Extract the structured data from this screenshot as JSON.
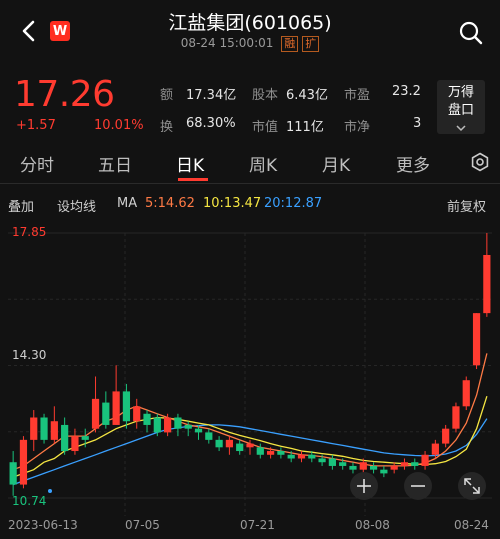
{
  "header": {
    "title": "江盐集团(601065)",
    "datetime": "08-24 15:00:01",
    "tag1": "融",
    "tag2": "扩",
    "logo_text": "W"
  },
  "quote": {
    "price": "17.26",
    "change": "+1.57",
    "change_pct": "10.01%",
    "stats": [
      {
        "label": "额",
        "value": "17.34亿"
      },
      {
        "label": "股本",
        "value": "6.43亿"
      },
      {
        "label": "市盈",
        "value": "23.2"
      },
      {
        "label": "换",
        "value": "68.30%"
      },
      {
        "label": "市值",
        "value": "111亿"
      },
      {
        "label": "市净",
        "value": "3"
      }
    ],
    "wande_line1": "万得",
    "wande_line2": "盘口"
  },
  "tabs": [
    "分时",
    "五日",
    "日K",
    "周K",
    "月K",
    "更多"
  ],
  "active_tab": "日K",
  "indicators": {
    "overlay": "叠加",
    "setma": "设均线",
    "ma": "MA",
    "ma5": "5:14.62",
    "ma10": "10:13.47",
    "ma20": "20:12.87",
    "adjust": "前复权"
  },
  "colors": {
    "up": "#ff3b30",
    "down": "#19c37d",
    "ma5": "#ff7a45",
    "ma10": "#f5e642",
    "ma20": "#3aa0ff"
  },
  "chart_data": {
    "type": "candlestick",
    "ylim": [
      10.74,
      17.85
    ],
    "y_high_label": "17.85",
    "y_mid_label": "14.30",
    "y_low_label": "10.74",
    "x_labels": [
      "2023-06-13",
      "07-05",
      "07-21",
      "08-08",
      "08-24"
    ],
    "candles": [
      [
        11.7,
        11.1,
        12.0,
        10.8
      ],
      [
        11.1,
        12.3,
        12.4,
        11.0
      ],
      [
        12.3,
        12.9,
        13.1,
        12.0
      ],
      [
        12.9,
        12.3,
        13.0,
        12.2
      ],
      [
        12.3,
        12.8,
        13.2,
        12.2
      ],
      [
        12.7,
        12.0,
        12.9,
        11.9
      ],
      [
        12.0,
        12.4,
        12.6,
        11.9
      ],
      [
        12.4,
        12.3,
        12.6,
        12.1
      ],
      [
        12.6,
        13.4,
        14.0,
        12.5
      ],
      [
        13.3,
        12.7,
        13.6,
        12.6
      ],
      [
        12.7,
        13.6,
        14.3,
        12.7
      ],
      [
        13.6,
        12.8,
        13.8,
        12.6
      ],
      [
        12.8,
        13.2,
        13.4,
        12.6
      ],
      [
        13.0,
        12.7,
        13.1,
        12.5
      ],
      [
        12.9,
        12.5,
        13.0,
        12.4
      ],
      [
        12.5,
        12.9,
        13.0,
        12.4
      ],
      [
        12.9,
        12.6,
        13.0,
        12.4
      ],
      [
        12.7,
        12.6,
        12.8,
        12.4
      ],
      [
        12.6,
        12.5,
        12.7,
        12.3
      ],
      [
        12.5,
        12.3,
        12.6,
        12.2
      ],
      [
        12.3,
        12.1,
        12.4,
        12.0
      ],
      [
        12.1,
        12.3,
        12.4,
        11.9
      ],
      [
        12.2,
        12.0,
        12.3,
        11.9
      ],
      [
        12.1,
        12.2,
        12.3,
        11.9
      ],
      [
        12.1,
        11.9,
        12.2,
        11.8
      ],
      [
        11.9,
        12.0,
        12.1,
        11.8
      ],
      [
        12.0,
        11.9,
        12.1,
        11.8
      ],
      [
        11.9,
        11.8,
        12.0,
        11.7
      ],
      [
        11.8,
        11.9,
        12.0,
        11.7
      ],
      [
        11.9,
        11.8,
        12.0,
        11.7
      ],
      [
        11.8,
        11.7,
        11.9,
        11.6
      ],
      [
        11.8,
        11.6,
        11.9,
        11.5
      ],
      [
        11.7,
        11.6,
        11.8,
        11.5
      ],
      [
        11.6,
        11.5,
        11.7,
        11.4
      ],
      [
        11.5,
        11.7,
        11.8,
        11.4
      ],
      [
        11.6,
        11.5,
        11.7,
        11.4
      ],
      [
        11.5,
        11.4,
        11.6,
        11.3
      ],
      [
        11.5,
        11.6,
        11.7,
        11.4
      ],
      [
        11.6,
        11.7,
        11.8,
        11.5
      ],
      [
        11.7,
        11.6,
        11.8,
        11.5
      ],
      [
        11.6,
        11.9,
        12.0,
        11.5
      ],
      [
        11.9,
        12.2,
        12.3,
        11.8
      ],
      [
        12.2,
        12.6,
        12.7,
        12.1
      ],
      [
        12.6,
        13.2,
        13.3,
        12.5
      ],
      [
        13.2,
        13.9,
        14.0,
        13.1
      ],
      [
        14.3,
        15.7,
        15.7,
        14.2
      ],
      [
        15.7,
        17.26,
        17.85,
        15.6
      ]
    ],
    "ma5": [
      11.5,
      11.6,
      11.8,
      12.0,
      12.2,
      12.4,
      12.4,
      12.4,
      12.6,
      12.8,
      12.9,
      13.1,
      13.2,
      13.1,
      13.0,
      12.9,
      12.8,
      12.7,
      12.65,
      12.6,
      12.5,
      12.4,
      12.3,
      12.2,
      12.1,
      12.05,
      12.0,
      11.95,
      11.9,
      11.88,
      11.85,
      11.8,
      11.75,
      11.7,
      11.65,
      11.6,
      11.6,
      11.6,
      11.6,
      11.62,
      11.68,
      11.8,
      12.0,
      12.3,
      12.75,
      13.5,
      14.62
    ],
    "ma10": [
      11.3,
      11.4,
      11.5,
      11.7,
      11.8,
      12.0,
      12.1,
      12.2,
      12.3,
      12.45,
      12.6,
      12.7,
      12.8,
      12.85,
      12.9,
      12.88,
      12.85,
      12.8,
      12.75,
      12.7,
      12.6,
      12.5,
      12.42,
      12.35,
      12.28,
      12.2,
      12.13,
      12.07,
      12.0,
      11.97,
      11.93,
      11.9,
      11.86,
      11.8,
      11.75,
      11.72,
      11.7,
      11.68,
      11.66,
      11.65,
      11.64,
      11.66,
      11.72,
      11.85,
      12.05,
      12.6,
      13.47
    ],
    "ma20": [
      11.1,
      11.2,
      11.3,
      11.4,
      11.5,
      11.6,
      11.7,
      11.8,
      11.9,
      12.0,
      12.1,
      12.2,
      12.3,
      12.4,
      12.5,
      12.58,
      12.62,
      12.66,
      12.68,
      12.7,
      12.7,
      12.68,
      12.65,
      12.6,
      12.55,
      12.5,
      12.45,
      12.4,
      12.35,
      12.3,
      12.25,
      12.2,
      12.15,
      12.1,
      12.05,
      12.0,
      11.95,
      11.92,
      11.9,
      11.88,
      11.87,
      11.88,
      11.92,
      12.0,
      12.15,
      12.45,
      12.87
    ]
  }
}
